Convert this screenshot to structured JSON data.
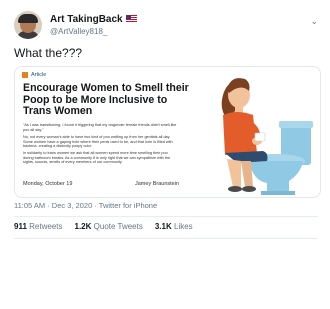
{
  "tweet": {
    "display_name": "Art TakingBack",
    "handle": "@ArtValley818_",
    "text": "What the???",
    "timestamp": "11:05 AM · Dec 3, 2020 · Twitter for iPhone",
    "retweets_count": "911",
    "retweets_label": "Retweets",
    "quote_count": "1.2K",
    "quote_label": "Quote Tweets",
    "likes_count": "3.1K",
    "likes_label": "Likes"
  },
  "article": {
    "tag": "Article",
    "headline": "Encourage Women to Smell their Poop to be More Inclusive to Trans Women",
    "paragraphs": [
      "\"As I was transitioning, I found it triggering that my cisgender female friends didn't smell like poo all day.\"",
      "No, not every woman's able to have two kind of poo wafting up from her genitals all day. Some women have a gaping hole where their penis used to be, and that hole is filled with bacteria, creating a distinctly poopy odor.",
      "In solidarity to trans women we ask that all women spend more time smelling their poo during bathroom breaks. As a community it is only right that we can sympathize with the sights, sounds, smells of every members of our community"
    ],
    "date": "Monday, October 19",
    "author": "Jamey Braunstein"
  },
  "colors": {
    "accent": "#1da1f2",
    "article_tag": "#e4821c",
    "shirt": "#e35d2b",
    "toilet": "#8fc9e3"
  }
}
